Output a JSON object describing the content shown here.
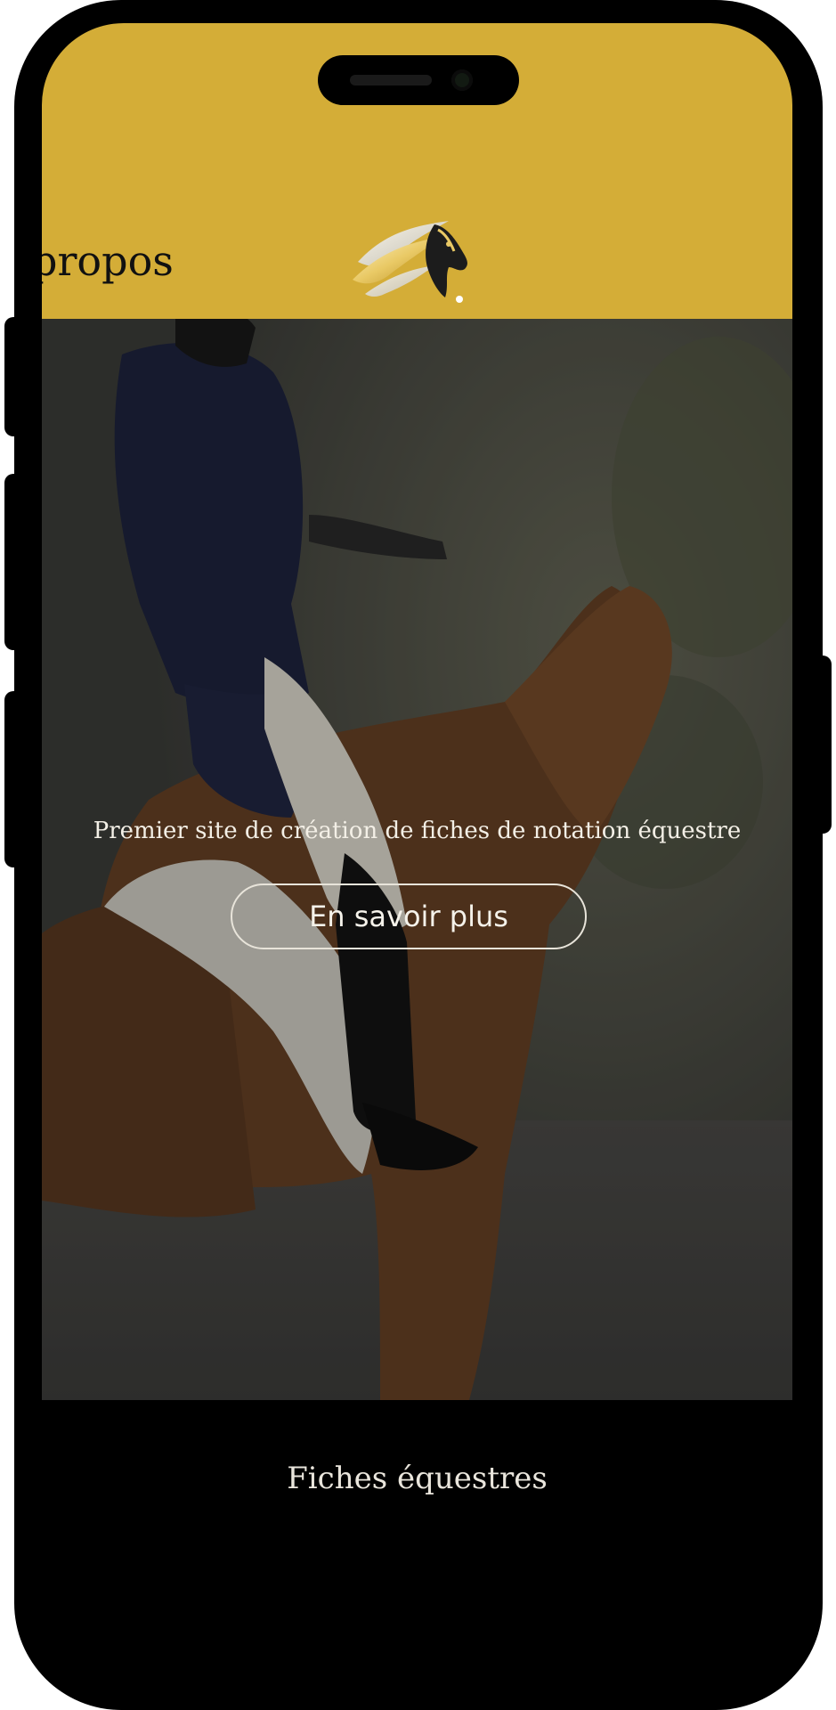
{
  "header": {
    "nav_partial_label": "propos",
    "logo_icon": "horse-head-icon",
    "background_color": "#d4ad37"
  },
  "hero": {
    "tagline": "Premier site de création de fiches de notation équestre",
    "cta_label": "En savoir plus",
    "background_image": "dressage rider on bay horse"
  },
  "footer": {
    "title": "Fiches équestres"
  },
  "colors": {
    "accent": "#d4ad37",
    "frame": "#000000"
  }
}
